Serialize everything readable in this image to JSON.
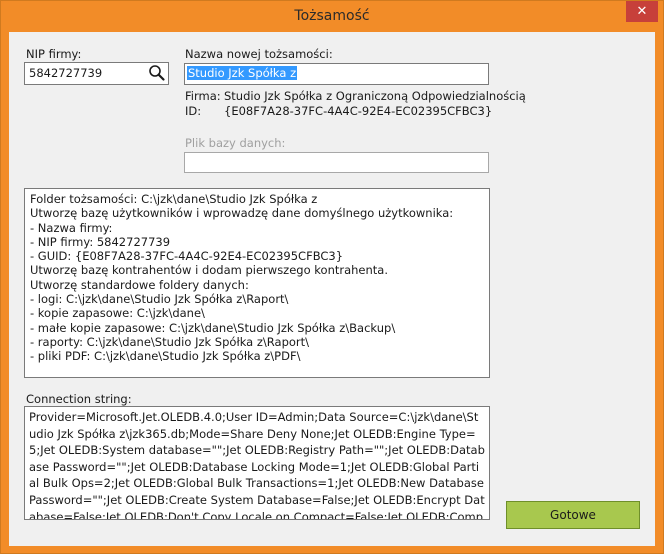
{
  "window": {
    "title": "Tożsamość",
    "close_glyph": "✕"
  },
  "nip": {
    "label": "NIP firmy:",
    "value": "5842727739",
    "icon": "search-icon"
  },
  "new_identity": {
    "label": "Nazwa nowej tożsamości:",
    "value": "Studio Jzk Spółka z"
  },
  "company": {
    "firma_label": "Firma:",
    "firma_value": "Studio Jzk Spółka z Ograniczoną Odpowiedzialnością",
    "id_label": "ID:",
    "id_value": "{E08F7A28-37FC-4A4C-92E4-EC02395CFBC3}"
  },
  "db_file": {
    "label": "Plik bazy danych:",
    "value": ""
  },
  "log_lines": [
    "Folder tożsamości: C:\\jzk\\dane\\Studio Jzk Spółka z",
    "Utworzę bazę użytkowników i wprowadzę dane domyślnego użytkownika:",
    "- Nazwa firmy:",
    "- NIP firmy: 5842727739",
    "- GUID: {E08F7A28-37FC-4A4C-92E4-EC02395CFBC3}",
    "Utworzę bazę kontrahentów i dodam pierwszego kontrahenta.",
    "Utworzę standardowe foldery danych:",
    "- logi: C:\\jzk\\dane\\Studio Jzk Spółka z\\Raport\\",
    "- kopie zapasowe: C:\\jzk\\dane\\",
    "- małe kopie zapasowe: C:\\jzk\\dane\\Studio Jzk Spółka z\\Backup\\",
    "- raporty: C:\\jzk\\dane\\Studio Jzk Spółka z\\Raport\\",
    "- pliki PDF: C:\\jzk\\dane\\Studio Jzk Spółka z\\PDF\\"
  ],
  "connection": {
    "label": "Connection string:",
    "value": "Provider=Microsoft.Jet.OLEDB.4.0;User ID=Admin;Data Source=C:\\jzk\\dane\\Studio Jzk Spółka z\\jzk365.db;Mode=Share Deny None;Jet OLEDB:Engine Type=5;Jet OLEDB:System database=\"\";Jet OLEDB:Registry Path=\"\";Jet OLEDB:Database Password=\"\";Jet OLEDB:Database Locking Mode=1;Jet OLEDB:Global Partial Bulk Ops=2;Jet OLEDB:Global Bulk Transactions=1;Jet OLEDB:New Database Password=\"\";Jet OLEDB:Create System Database=False;Jet OLEDB:Encrypt Database=False;Jet OLEDB:Don't Copy Locale on Compact=False;Jet OLEDB:Compact"
  },
  "ok_button": {
    "label": "Gotowe"
  },
  "colors": {
    "titlebar": "#f28c28",
    "close": "#c7403a",
    "ok_button": "#a8c84e",
    "selection": "#3399ff"
  }
}
